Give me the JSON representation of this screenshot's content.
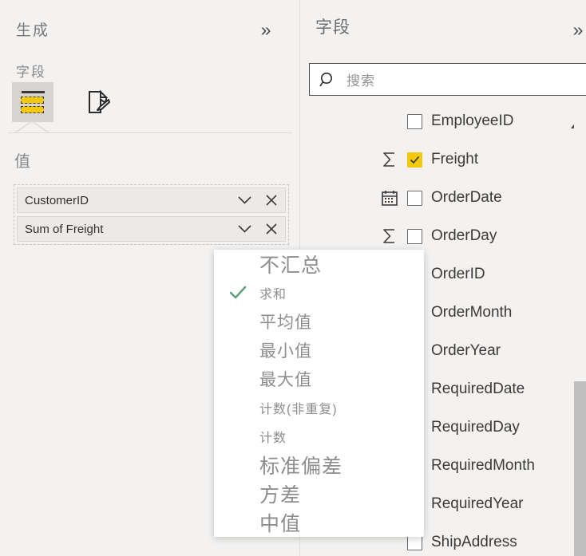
{
  "left_panel": {
    "title": "生成",
    "collapse_glyph": "»",
    "fields_subtitle": "字段",
    "tabs": [
      {
        "name": "fields-tab",
        "icon": "table-fields-icon",
        "selected": true
      },
      {
        "name": "format-tab",
        "icon": "paintbrush-format-icon",
        "selected": false
      }
    ],
    "values_label": "值",
    "value_chips": [
      {
        "label": "CustomerID",
        "dropdown_glyph": "⌄",
        "remove_glyph": "✕"
      },
      {
        "label": "Sum of Freight",
        "dropdown_glyph": "⌄",
        "remove_glyph": "✕"
      }
    ]
  },
  "right_panel": {
    "title": "字段",
    "collapse_glyph": "»",
    "search": {
      "placeholder": "搜索",
      "value": "",
      "icon": "search-icon"
    },
    "scroll_up_glyph": "▲",
    "fields": [
      {
        "label": "EmployeeID",
        "checked": false,
        "type_icon": "none"
      },
      {
        "label": "Freight",
        "checked": true,
        "type_icon": "sigma"
      },
      {
        "label": "OrderDate",
        "checked": false,
        "type_icon": "calendar"
      },
      {
        "label": "OrderDay",
        "checked": false,
        "type_icon": "sigma"
      },
      {
        "label": "OrderID",
        "checked": false,
        "type_icon": "none"
      },
      {
        "label": "OrderMonth",
        "checked": false,
        "type_icon": "none"
      },
      {
        "label": "OrderYear",
        "checked": false,
        "type_icon": "none"
      },
      {
        "label": "RequiredDate",
        "checked": false,
        "type_icon": "none"
      },
      {
        "label": "RequiredDay",
        "checked": false,
        "type_icon": "none"
      },
      {
        "label": "RequiredMonth",
        "checked": false,
        "type_icon": "none"
      },
      {
        "label": "RequiredYear",
        "checked": false,
        "type_icon": "none"
      },
      {
        "label": "ShipAddress",
        "checked": false,
        "type_icon": "none"
      }
    ]
  },
  "aggregation_menu": {
    "check_glyph": "✓",
    "accent_check_color": "#5a9e78",
    "items": [
      {
        "label": "不汇总",
        "selected": false,
        "size": "lg"
      },
      {
        "label": "求和",
        "selected": true,
        "size": "sm"
      },
      {
        "label": "平均值",
        "selected": false,
        "size": "md"
      },
      {
        "label": "最小值",
        "selected": false,
        "size": "md"
      },
      {
        "label": "最大值",
        "selected": false,
        "size": "md"
      },
      {
        "label": "计数(非重复)",
        "selected": false,
        "size": "sm"
      },
      {
        "label": "计数",
        "selected": false,
        "size": "sm"
      },
      {
        "label": "标准偏差",
        "selected": false,
        "size": "lg"
      },
      {
        "label": "方差",
        "selected": false,
        "size": "lg"
      },
      {
        "label": "中值",
        "selected": false,
        "size": "lg"
      }
    ]
  },
  "colors": {
    "background": "#f3f2f1",
    "accent_yellow": "#f2c811",
    "check_green": "#5a9e78",
    "scrollbar": "#bfbfbf",
    "text_dark": "#3b3a39",
    "text_muted": "#8e8e8e"
  }
}
